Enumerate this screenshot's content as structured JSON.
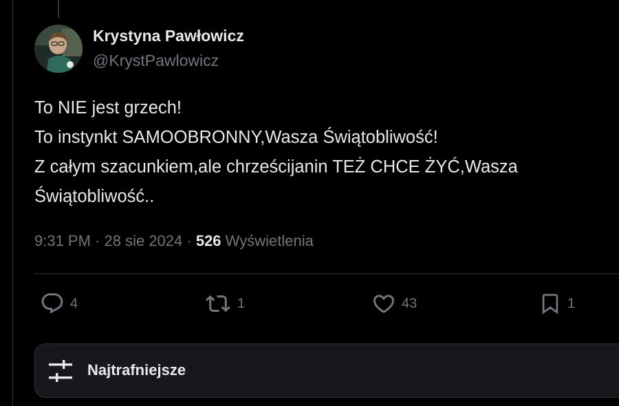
{
  "tweet": {
    "author": {
      "name": "Krystyna Pawłowicz",
      "handle": "@KrystPawlowicz"
    },
    "text_lines": [
      "To NIE jest grzech!",
      "To instynkt SAMOOBRONNY,Wasza Świątobliwość!",
      "Z całym szacunkiem,ale chrześcijanin TEŻ CHCE ŻYĆ,Wasza",
      "Świątobliwość.."
    ],
    "meta": {
      "time": "9:31 PM",
      "separator": " · ",
      "date": "28 sie 2024",
      "views_count": "526",
      "views_label": "Wyświetlenia"
    },
    "actions": {
      "replies": "4",
      "reposts": "1",
      "likes": "43",
      "bookmarks": "1"
    }
  },
  "sort": {
    "label": "Najtrafniejsze"
  },
  "colors": {
    "background": "#000000",
    "text_primary": "#e7e9ea",
    "text_secondary": "#71767b",
    "border": "#2f3336",
    "panel": "#16181c"
  },
  "icons": [
    "reply-icon",
    "repost-icon",
    "like-icon",
    "bookmark-icon",
    "sort-sliders-icon"
  ]
}
